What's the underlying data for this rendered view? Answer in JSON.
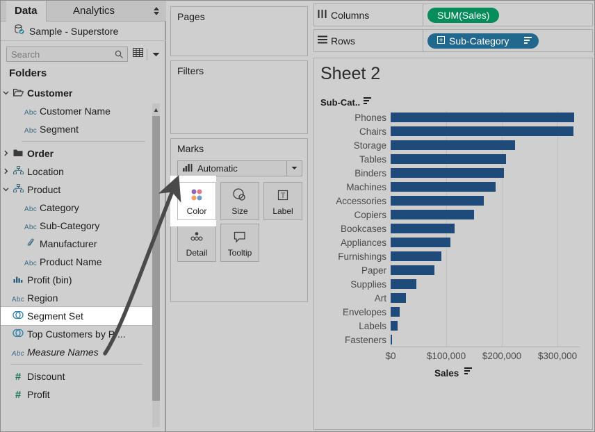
{
  "window": {
    "background": "#cfcfcf",
    "accent_green": "#078c5c",
    "accent_blue": "#21688f",
    "bar_color": "#1f4b7a"
  },
  "data_pane": {
    "tabs": [
      {
        "label": "Data",
        "active": true
      },
      {
        "label": "Analytics",
        "active": false
      }
    ],
    "datasource": {
      "label": "Sample - Superstore",
      "icon": "database-icon"
    },
    "search": {
      "placeholder": "Search",
      "value": "",
      "icon": "search-icon"
    },
    "view_grid_icon": "grid-view-icon",
    "view_menu_icon": "chevron-down-icon",
    "folders_header": "Folders",
    "tree": [
      {
        "label": "Customer",
        "icon": "folder-open-icon",
        "twisty": "expanded",
        "indent": 0,
        "bold": true,
        "italic": false,
        "selected": false
      },
      {
        "label": "Customer Name",
        "icon": "abc-icon",
        "twisty": "none",
        "indent": 1,
        "bold": false,
        "italic": false,
        "selected": false
      },
      {
        "label": "Segment",
        "icon": "abc-icon",
        "twisty": "none",
        "indent": 1,
        "bold": false,
        "italic": false,
        "selected": false
      },
      {
        "separator": true,
        "indent": 1
      },
      {
        "label": "Order",
        "icon": "folder-closed-icon",
        "twisty": "collapsed",
        "indent": 0,
        "bold": true,
        "italic": false,
        "selected": false
      },
      {
        "label": "Location",
        "icon": "hierarchy-icon",
        "twisty": "collapsed",
        "indent": 0,
        "bold": false,
        "italic": false,
        "selected": false
      },
      {
        "label": "Product",
        "icon": "hierarchy-icon",
        "twisty": "expanded",
        "indent": 0,
        "bold": false,
        "italic": false,
        "selected": false
      },
      {
        "label": "Category",
        "icon": "abc-icon",
        "twisty": "none",
        "indent": 1,
        "bold": false,
        "italic": false,
        "selected": false
      },
      {
        "label": "Sub-Category",
        "icon": "abc-icon",
        "twisty": "none",
        "indent": 1,
        "bold": false,
        "italic": false,
        "selected": false
      },
      {
        "label": "Manufacturer",
        "icon": "calculated-field-icon",
        "twisty": "none",
        "indent": 1,
        "bold": false,
        "italic": false,
        "selected": false
      },
      {
        "label": "Product Name",
        "icon": "abc-icon",
        "twisty": "none",
        "indent": 1,
        "bold": false,
        "italic": false,
        "selected": false
      },
      {
        "label": "Profit (bin)",
        "icon": "bin-icon",
        "twisty": "none",
        "indent": 0,
        "bold": false,
        "italic": false,
        "selected": false
      },
      {
        "label": "Region",
        "icon": "abc-icon",
        "twisty": "none",
        "indent": 0,
        "bold": false,
        "italic": false,
        "selected": false
      },
      {
        "label": "Segment Set",
        "icon": "set-icon",
        "twisty": "none",
        "indent": 0,
        "bold": false,
        "italic": false,
        "selected": true
      },
      {
        "label": "Top Customers by Pr...",
        "icon": "set-icon",
        "twisty": "none",
        "indent": 0,
        "bold": false,
        "italic": false,
        "selected": false
      },
      {
        "label": "Measure Names",
        "icon": "abc-icon",
        "twisty": "none",
        "indent": 0,
        "bold": false,
        "italic": true,
        "selected": false
      },
      {
        "separator": true,
        "indent": 0
      },
      {
        "label": "Discount",
        "icon": "number-icon",
        "twisty": "none",
        "indent": 0,
        "bold": false,
        "italic": false,
        "selected": false
      },
      {
        "label": "Profit",
        "icon": "number-icon",
        "twisty": "none",
        "indent": 0,
        "bold": false,
        "italic": false,
        "selected": false
      }
    ]
  },
  "shelf_pane": {
    "pages": {
      "title": "Pages"
    },
    "filters": {
      "title": "Filters"
    },
    "marks": {
      "title": "Marks",
      "mark_type": {
        "value": "Automatic",
        "icon": "bar-mark-icon",
        "dropdown_icon": "chevron-down-icon"
      },
      "buttons": [
        {
          "label": "Color",
          "icon": "color-icon",
          "highlighted": true
        },
        {
          "label": "Size",
          "icon": "size-icon",
          "highlighted": false
        },
        {
          "label": "Label",
          "icon": "label-icon",
          "highlighted": false
        },
        {
          "label": "Detail",
          "icon": "detail-icon",
          "highlighted": false
        },
        {
          "label": "Tooltip",
          "icon": "tooltip-icon",
          "highlighted": false
        }
      ]
    }
  },
  "shelves": {
    "columns": {
      "label": "Columns",
      "icon": "columns-icon",
      "pill": {
        "text": "SUM(Sales)",
        "color": "green",
        "has_expand": false,
        "has_sort": false
      }
    },
    "rows": {
      "label": "Rows",
      "icon": "rows-icon",
      "pill": {
        "text": "Sub-Category",
        "color": "blue",
        "has_expand": true,
        "has_sort": true
      }
    }
  },
  "viz": {
    "sheet_title": "Sheet 2",
    "row_header_title": "Sub-Cat..",
    "row_header_sort_icon": "sort-descending-icon"
  },
  "chart_data": {
    "type": "bar",
    "title": "Sheet 2",
    "orientation": "horizontal",
    "xlabel": "Sales",
    "ylabel": "Sub-Cat..",
    "xlim": [
      0,
      340000
    ],
    "grid": true,
    "legend": "none",
    "tick_labels": [
      "$0",
      "$100,000",
      "$200,000",
      "$300,000"
    ],
    "tick_values": [
      0,
      100000,
      200000,
      300000
    ],
    "sort": "descending",
    "categories": [
      "Phones",
      "Chairs",
      "Storage",
      "Tables",
      "Binders",
      "Machines",
      "Accessories",
      "Copiers",
      "Bookcases",
      "Appliances",
      "Furnishings",
      "Paper",
      "Supplies",
      "Art",
      "Envelopes",
      "Labels",
      "Fasteners"
    ],
    "values": [
      330007,
      328449,
      223844,
      206966,
      203413,
      189239,
      167380,
      149528,
      114880,
      107532,
      91705,
      78479,
      46674,
      27119,
      16476,
      12486,
      3024
    ]
  }
}
